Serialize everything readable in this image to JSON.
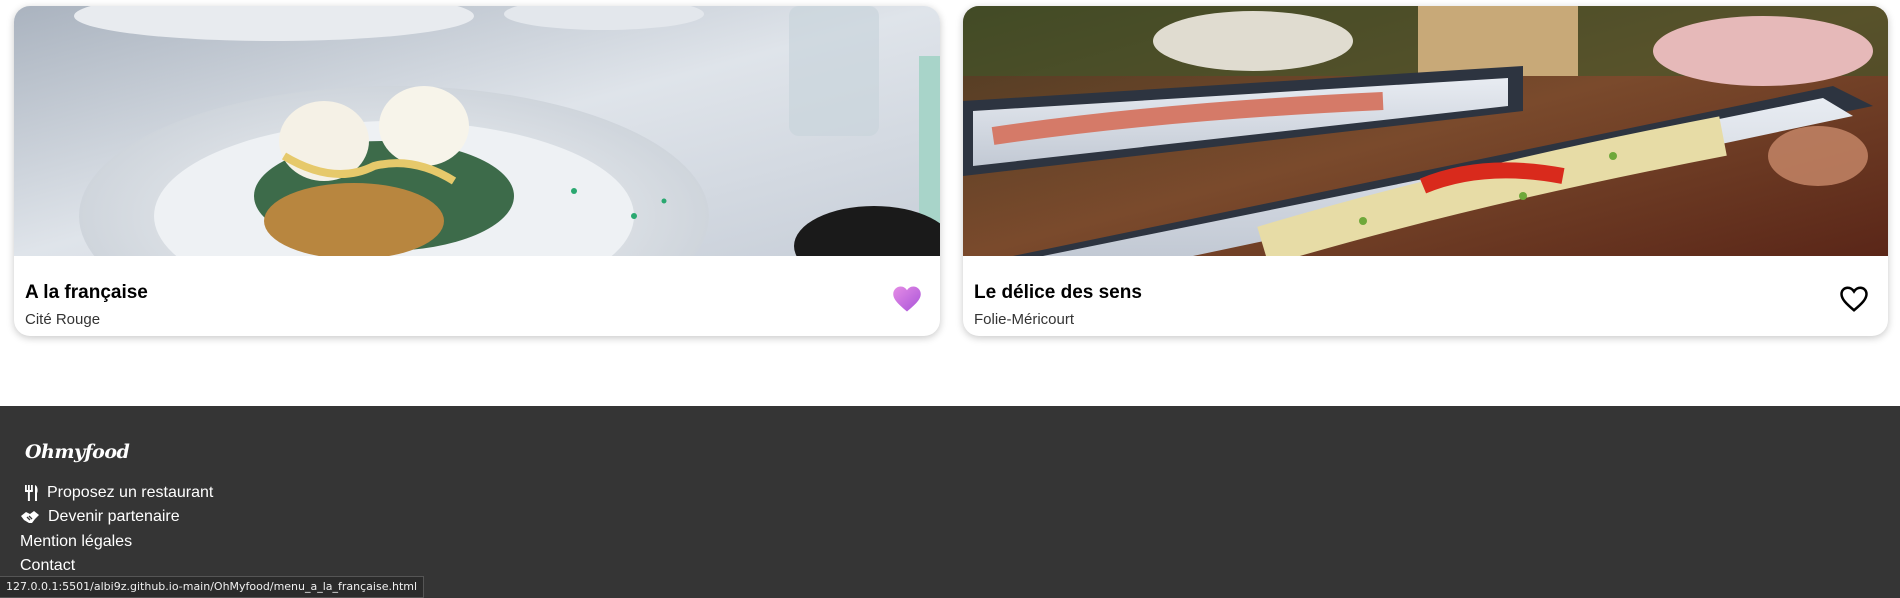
{
  "cards": [
    {
      "title": "A la française",
      "location": "Cité Rouge",
      "favorited": true,
      "heart_color": "#c56cdd",
      "image_icon": "food-photo-poached-eggs"
    },
    {
      "title": "Le délice des sens",
      "location": "Folie-Méricourt",
      "favorited": false,
      "heart_color": "#000000",
      "image_icon": "food-photo-fish-plates"
    }
  ],
  "footer": {
    "logo": "Ohmyfood",
    "background": "#353535",
    "links": [
      {
        "label": "Proposez un restaurant",
        "icon": "utensils-icon"
      },
      {
        "label": "Devenir partenaire",
        "icon": "handshake-icon"
      },
      {
        "label": "Mention légales"
      },
      {
        "label": "Contact"
      }
    ]
  },
  "status_bar": {
    "url": "127.0.0.1:5501/albi9z.github.io-main/OhMyfood/menu_a_la_française.html"
  }
}
